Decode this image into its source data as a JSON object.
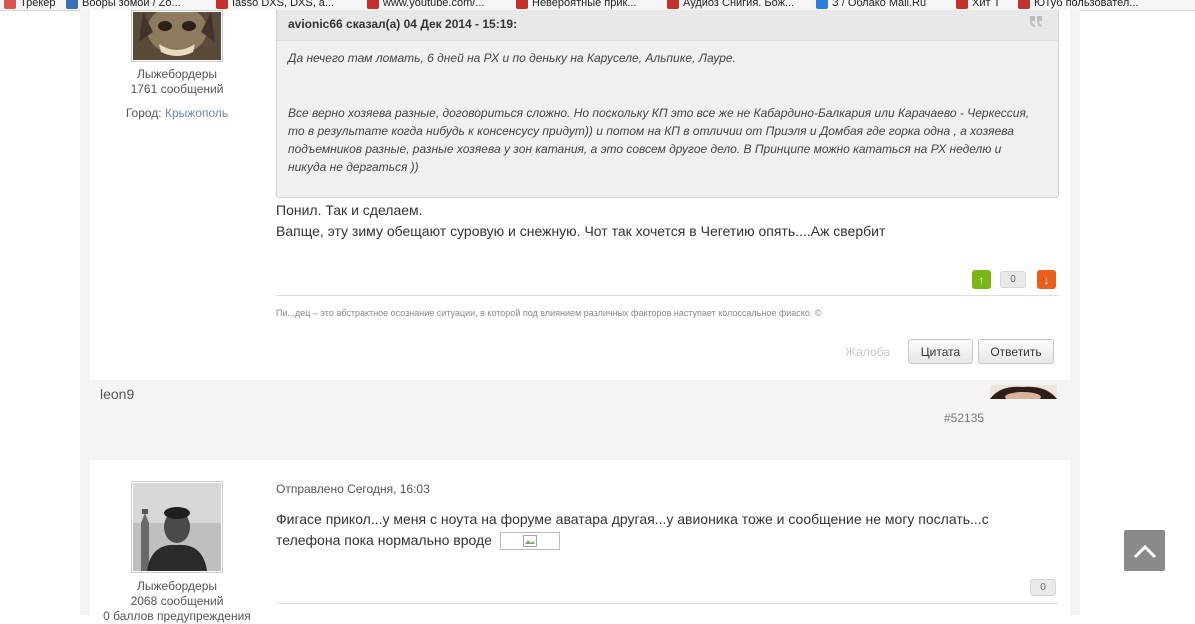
{
  "bookmarks": [
    {
      "label": "Трекер",
      "color": "#d9534f"
    },
    {
      "label": "Вооры зомой / Zo...",
      "color": "#3b6fb6"
    },
    {
      "label": "Iasso DXS, DXS, a...",
      "color": "#c4302b"
    },
    {
      "label": "www.youtube.com/...",
      "color": "#c4302b"
    },
    {
      "label": "Невероятные прик...",
      "color": "#c4302b"
    },
    {
      "label": "Аудиоз Снигия. Бож...",
      "color": "#c4302b"
    },
    {
      "label": "З / Облако Mail.Ru",
      "color": "#2f7fd8"
    },
    {
      "label": "Хит Т",
      "color": "#c4302b"
    },
    {
      "label": "ЮТуб пользовател...",
      "color": "#c4302b"
    }
  ],
  "post1": {
    "author_group": "Лыжебордеры",
    "messages_count": "1761 сообщений",
    "city_label": "Город:",
    "city_value": "Крыжополь",
    "quote_author": "avionic66 сказал(а) 04 Дек 2014 - 15:19:",
    "quote_p1": "Да нечего там ломать, 6 дней на РХ и по деньку на Каруселе, Альпике, Лауре.",
    "quote_p2_l1": "Все верно хозяева разные, договориться сложно. Но поскольку КП это все же не Кабардино-Балкария или Карачаево - Черкессия,",
    "quote_p2_l2": "то в результате когда нибудь к консенсусу придут)) и потом на КП в отличии от Приэля и Домбая где горка одна , а хозяева",
    "quote_p2_l3": "подъемников разные, разные хозяева у зон катания, а это совсем другое дело. В Принципе можно кататься на РХ неделю и",
    "quote_p2_l4": "никуда не дергаться ))",
    "text_line1": "Понил. Так и сделаем.",
    "text_line2": "Вапще, эту зиму обещают суровую и снежную. Чот так хочется в Чегетию опять....Аж свербит",
    "vote_up": "↑",
    "vote_count": "0",
    "vote_down": "↓",
    "signature": "Пи...дец – это абстрактное осознание ситуации, в которой под влиянием различных факторов наступает колоссальное фиаско. ©",
    "complaint": "Жалоба",
    "quote_btn": "Цитата",
    "reply_btn": "Ответить"
  },
  "post2_header": {
    "username": "leon9",
    "post_number": "#52135"
  },
  "post2": {
    "sent": "Отправлено Сегодня, 16:03",
    "text_line1": "Фигасе прикол...у меня с ноута на форуме аватара другая...у авионика тоже и сообщение не могу послать...с",
    "text_line2": "телефона пока нормально вроде",
    "author_group": "Лыжебордеры",
    "messages_count": "2068 сообщений",
    "warnings": "0 баллов предупреждения",
    "vote_count": "0"
  },
  "icons": {
    "scroll_top": "chevron-up-icon",
    "vote_up": "arrow-up-icon",
    "vote_down": "arrow-down-icon",
    "quote_corner": "quote-icon"
  },
  "colors": {
    "vote_up": "#7cb518",
    "vote_down": "#e8601c",
    "link": "#6a8aa8",
    "scroll_top": "#8a8a8a"
  }
}
